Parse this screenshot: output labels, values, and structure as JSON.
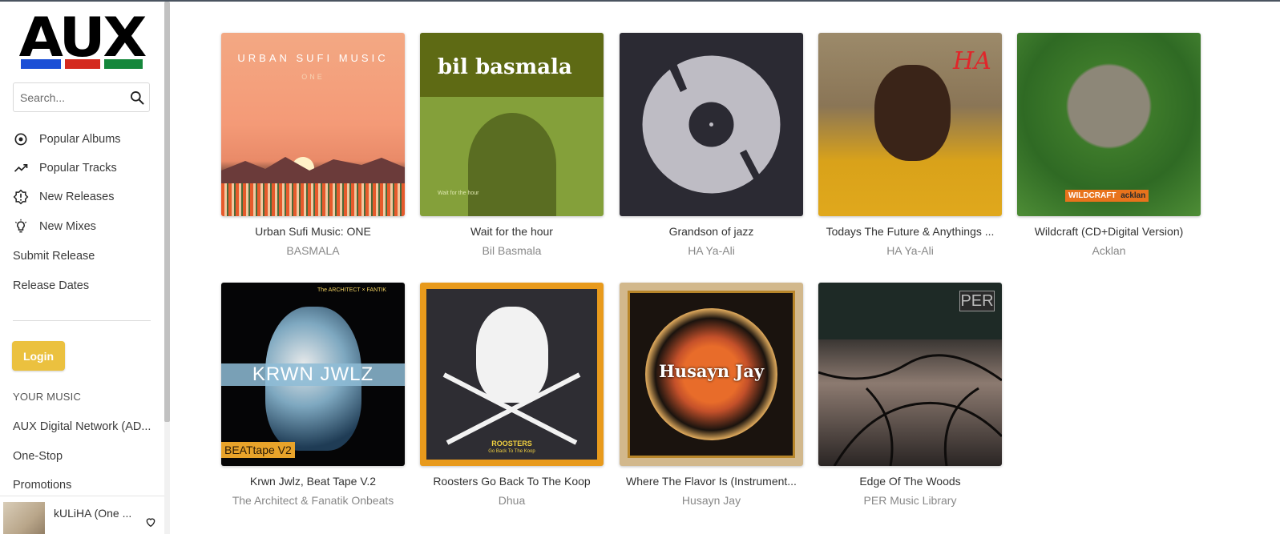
{
  "brand": {
    "logo_text": "AUX",
    "stripe_colors": [
      "#1b4fd6",
      "#d42a1e",
      "#15873b"
    ]
  },
  "search": {
    "placeholder": "Search..."
  },
  "nav": [
    {
      "label": "Popular Albums",
      "icon": "disc-icon"
    },
    {
      "label": "Popular Tracks",
      "icon": "trending-icon"
    },
    {
      "label": "New Releases",
      "icon": "new-releases-icon"
    },
    {
      "label": "New Mixes",
      "icon": "lightbulb-icon"
    },
    {
      "label": "Submit Release",
      "icon": ""
    },
    {
      "label": "Release Dates",
      "icon": ""
    }
  ],
  "login_label": "Login",
  "your_music": {
    "heading": "YOUR MUSIC",
    "items": [
      "AUX Digital Network (AD...",
      "One-Stop",
      "Promotions"
    ]
  },
  "now_playing": {
    "title": "kULiHA (One ..."
  },
  "albums": [
    {
      "title": "Urban Sufi Music: ONE",
      "artist": "BASMALA",
      "art_text": "URBAN SUFI MUSIC",
      "art_sub": "ONE"
    },
    {
      "title": "Wait for the hour",
      "artist": "Bil Basmala",
      "art_text": "bil basmala",
      "art_sub": "Wait for the hour"
    },
    {
      "title": "Grandson of jazz",
      "artist": "HA Ya-Ali"
    },
    {
      "title": "Todays The Future & Anythings ...",
      "artist": "HA Ya-Ali",
      "art_text": "HA"
    },
    {
      "title": "Wildcraft (CD+Digital Version)",
      "artist": "Acklan",
      "art_text": "WILDCRAFT",
      "art_sub": "acklan"
    },
    {
      "title": "Krwn Jwlz, Beat Tape V.2",
      "artist": "The Architect & Fanatik Onbeats",
      "art_text": "KRWN JWLZ",
      "art_sub": "BEATtape V2",
      "art_top": "The ARCHITECT × FANTIK"
    },
    {
      "title": "Roosters Go Back To The Koop",
      "artist": "Dhua",
      "art_text": "ROOSTERS",
      "art_sub": "Go Back To The Koop"
    },
    {
      "title": "Where The Flavor Is (Instrument...",
      "artist": "Husayn Jay",
      "art_text": "Husayn Jay"
    },
    {
      "title": "Edge Of The Woods",
      "artist": "PER Music Library",
      "art_text": "PER"
    }
  ]
}
